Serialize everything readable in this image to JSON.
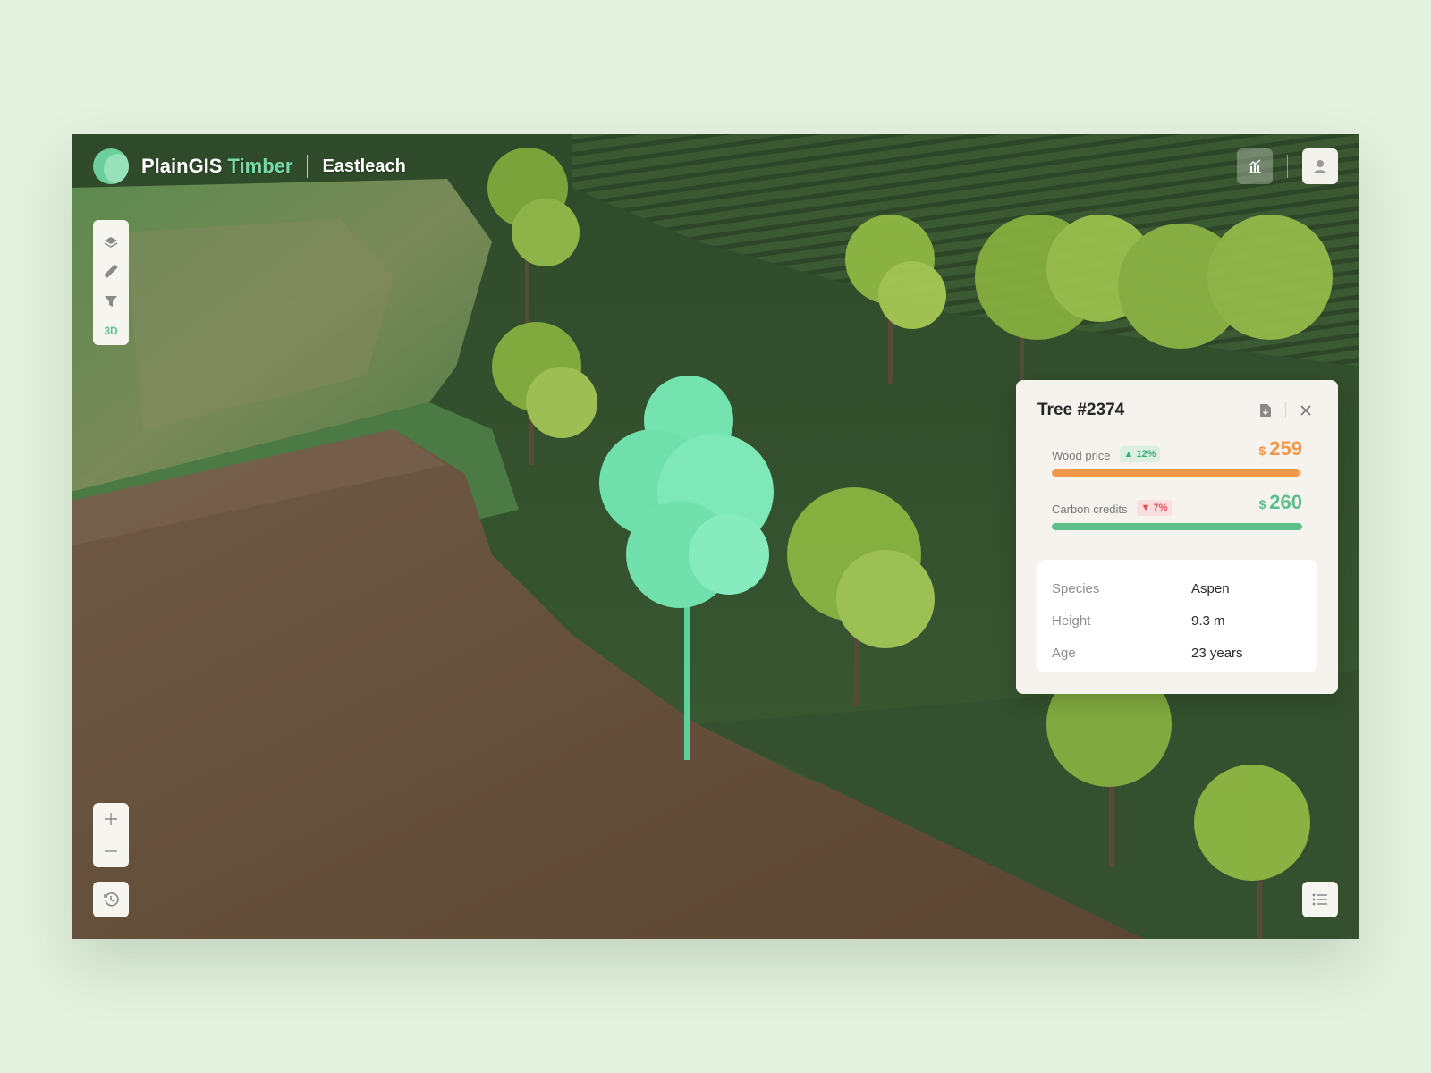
{
  "app": {
    "brand": "PlainGIS",
    "product": "Timber",
    "location": "Eastleach"
  },
  "header": {
    "analytics_icon": "chart-icon",
    "user_icon": "user-icon"
  },
  "toolbar": {
    "items": [
      {
        "icon": "layers-icon"
      },
      {
        "icon": "ruler-icon"
      },
      {
        "icon": "filter-icon"
      },
      {
        "label": "3D"
      }
    ]
  },
  "zoom": {
    "in": "+",
    "out": "–"
  },
  "panel": {
    "title": "Tree #2374",
    "metrics": [
      {
        "label": "Wood price",
        "change": "▲ 12%",
        "currency": "$",
        "value": "259",
        "fill": 0.99,
        "color": "#f0994a"
      },
      {
        "label": "Carbon credits",
        "change": "▼ 7%",
        "currency": "$",
        "value": "260",
        "fill": 1.0,
        "color": "#5cbf8b"
      }
    ],
    "properties": [
      {
        "key": "Species",
        "value": "Aspen"
      },
      {
        "key": "Height",
        "value": "9.3 m"
      },
      {
        "key": "Age",
        "value": "23 years"
      }
    ]
  },
  "colors": {
    "accent": "#5cc493",
    "highlight_tree": "#6fe2ad",
    "wood_price": "#f0994a",
    "carbon": "#5cbf8b"
  }
}
